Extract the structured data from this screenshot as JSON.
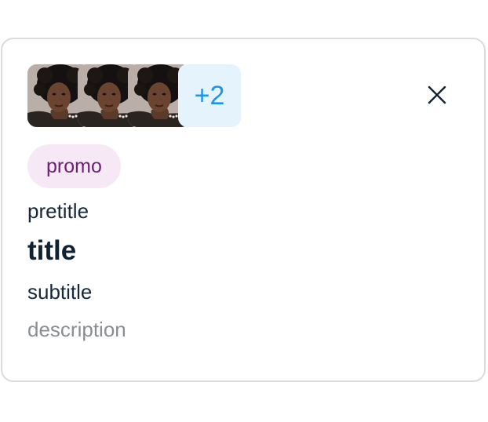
{
  "card": {
    "avatars": [
      {
        "name": "avatar-photo"
      },
      {
        "name": "avatar-photo"
      },
      {
        "name": "avatar-photo"
      }
    ],
    "more_count": "+2",
    "close_icon": "close-icon",
    "tag": "promo",
    "pretitle": "pretitle",
    "title": "title",
    "subtitle": "subtitle",
    "description": "description"
  },
  "colors": {
    "tag_bg": "#f6e8f5",
    "tag_text": "#6c2171",
    "more_bg": "#e5f3fd",
    "more_text": "#1e96e8",
    "border": "#d9dcdf",
    "description": "#8a8e92"
  }
}
